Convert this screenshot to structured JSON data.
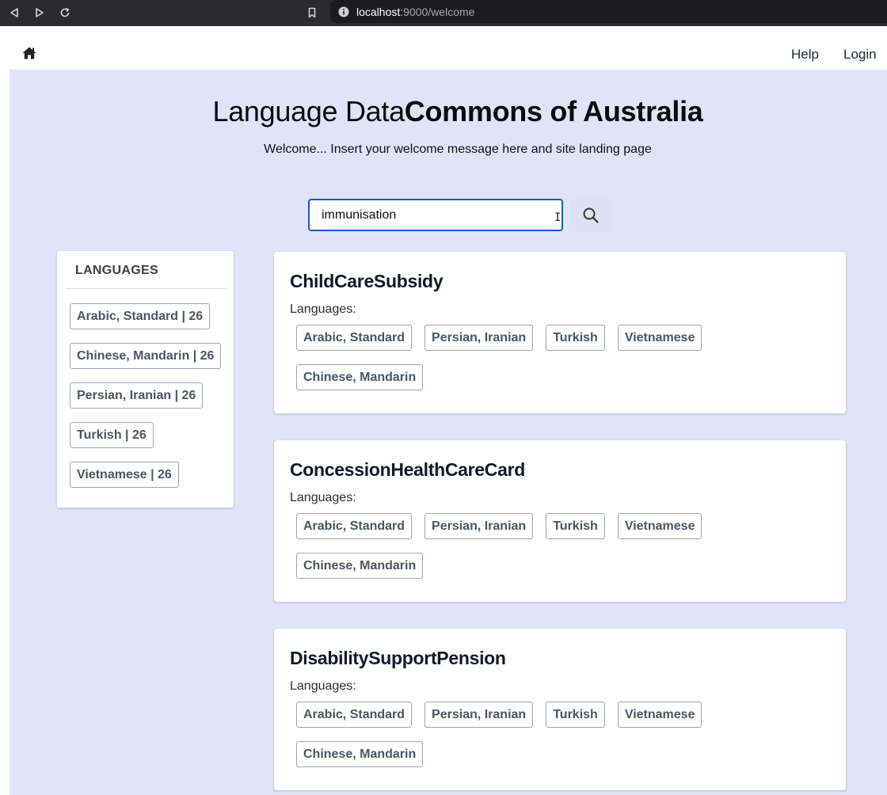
{
  "browser": {
    "url_host": "localhost",
    "url_rest": ":9000/welcome"
  },
  "header": {
    "help_label": "Help",
    "login_label": "Login"
  },
  "hero": {
    "title_light": "Language Data",
    "title_bold": "Commons of Australia",
    "subtitle": "Welcome... Insert your welcome message here and site landing page"
  },
  "search": {
    "value": "immunisation"
  },
  "facets": {
    "title": "LANGUAGES",
    "items": [
      {
        "label": "Arabic, Standard | 26"
      },
      {
        "label": "Chinese, Mandarin | 26"
      },
      {
        "label": "Persian, Iranian | 26"
      },
      {
        "label": "Turkish | 26"
      },
      {
        "label": "Vietnamese | 26"
      }
    ]
  },
  "results": [
    {
      "title": "ChildCareSubsidy",
      "languages_label": "Languages:",
      "languages": [
        "Arabic, Standard",
        "Persian, Iranian",
        "Turkish",
        "Vietnamese",
        "Chinese, Mandarin"
      ]
    },
    {
      "title": "ConcessionHealthCareCard",
      "languages_label": "Languages:",
      "languages": [
        "Arabic, Standard",
        "Persian, Iranian",
        "Turkish",
        "Vietnamese",
        "Chinese, Mandarin"
      ]
    },
    {
      "title": "DisabilitySupportPension",
      "languages_label": "Languages:",
      "languages": [
        "Arabic, Standard",
        "Persian, Iranian",
        "Turkish",
        "Vietnamese",
        "Chinese, Mandarin"
      ]
    }
  ],
  "colors": {
    "page_background": "#e0e4fb",
    "search_border": "#1e5bb8",
    "chip_border": "#9ca3af"
  },
  "icons": [
    "back-icon",
    "forward-icon",
    "reload-icon",
    "bookmark-icon",
    "info-icon",
    "home-icon",
    "search-icon"
  ]
}
